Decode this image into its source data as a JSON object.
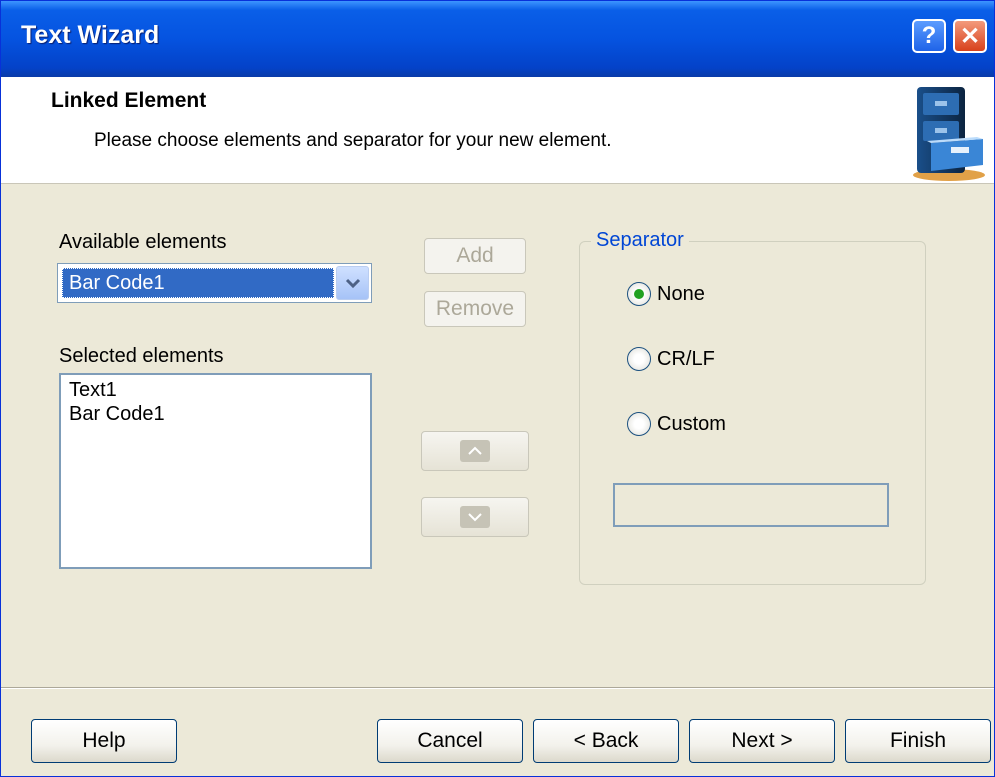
{
  "window": {
    "title": "Text Wizard",
    "help_glyph": "?",
    "close_glyph": "✕"
  },
  "header": {
    "title": "Linked Element",
    "subtitle": "Please choose elements and separator for your new element."
  },
  "available": {
    "label": "Available elements",
    "selected": "Bar Code1"
  },
  "selected_elements": {
    "label": "Selected elements",
    "items": [
      "Text1",
      "Bar Code1"
    ]
  },
  "actions": {
    "add": "Add",
    "remove": "Remove"
  },
  "separator": {
    "legend": "Separator",
    "options": [
      "None",
      "CR/LF",
      "Custom"
    ],
    "selected": "None",
    "custom_value": ""
  },
  "footer": {
    "help": "Help",
    "cancel": "Cancel",
    "back": "< Back",
    "next": "Next >",
    "finish": "Finish"
  },
  "colors": {
    "titlebar": "#0553e0",
    "selection": "#316ac5",
    "accent": "#0046d5",
    "radio_dot": "#21a121"
  }
}
